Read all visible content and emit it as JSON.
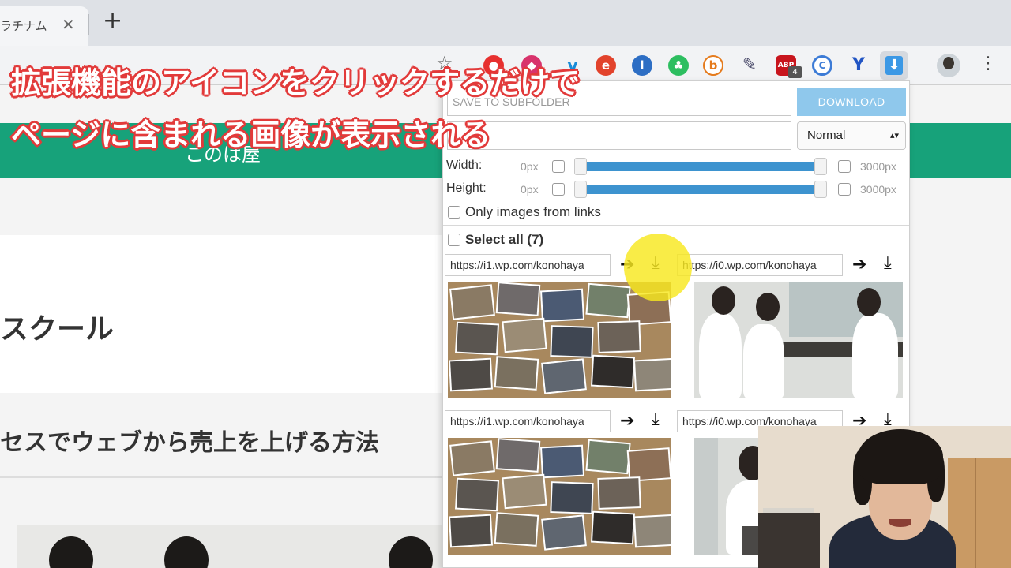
{
  "browser": {
    "tab_title": "ラチナム",
    "tab_close_glyph": "✕",
    "new_tab_glyph": "+",
    "star_glyph": "☆",
    "menu_glyph": "⋮",
    "extensions": {
      "adblock_label": "ABP",
      "adblock_badge": "4",
      "download_glyph": "⬇",
      "icons": [
        "red-extension-icon",
        "pink-extension-icon",
        "y-extension-icon",
        "e-extension-icon",
        "l-extension-icon",
        "evernote-icon",
        "b-extension-icon",
        "color-picker-icon",
        "adblock-icon",
        "c-extension-icon",
        "v-extension-icon",
        "image-downloader-icon"
      ]
    }
  },
  "page": {
    "site_name": "このは屋",
    "card1_title": "スクール",
    "card2_title": "セスでウェブから売上を上げる方法"
  },
  "popup": {
    "subfolder_placeholder": "SAVE TO SUBFOLDER",
    "filter_value": "",
    "download_label": "DOWNLOAD",
    "mode_value": "Normal",
    "mode_caret": "▴▾",
    "width_label": "Width:",
    "height_label": "Height:",
    "min_value": "0px",
    "max_value": "3000px",
    "width_range": [
      0,
      3000
    ],
    "height_range": [
      0,
      3000
    ],
    "only_links_label": "Only images from links",
    "select_all_label": "Select all (7)",
    "open_glyph": "➔",
    "download_glyph": "⤓",
    "images": [
      {
        "url": "https://i1.wp.com/konohaya",
        "kind": "collage"
      },
      {
        "url": "https://i0.wp.com/konohaya",
        "kind": "office-group"
      },
      {
        "url": "https://i1.wp.com/konohaya",
        "kind": "collage"
      },
      {
        "url": "https://i0.wp.com/konohaya",
        "kind": "office-single"
      }
    ]
  },
  "captions": {
    "line1": "拡張機能のアイコンをクリックするだけで",
    "line2": "ページに含まれる画像が表示される"
  },
  "colors": {
    "site_header": "#17a27a",
    "download_button": "#8fc8ec",
    "slider_track": "#3d93cf",
    "caption_outline": "#e23a3a",
    "cursor_highlight": "#f8e81e"
  }
}
